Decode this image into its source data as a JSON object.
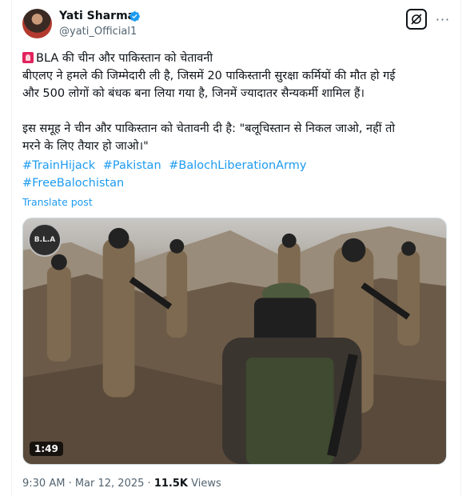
{
  "author": {
    "name": "Yati Sharma",
    "handle": "@yati_Official1",
    "verified": true,
    "verified_color": "#1d9bf0"
  },
  "header_actions": {
    "grok_icon": "grok-icon",
    "more_icon": "more-icon",
    "more_label": "···"
  },
  "tweet": {
    "line1": "BLA की चीन और पाकिस्तान को चेतावनी",
    "line2": "बीएलए ने हमले की जिम्मेदारी ली है, जिसमें 20 पाकिस्तानी सुरक्षा कर्मियों की मौत हो गई",
    "line3": "और 500 लोगों को बंधक बना लिया गया है, जिनमें ज्यादातर सैन्यकर्मी शामिल हैं।",
    "line4": "इस समूह ने चीन और पाकिस्तान को चेतावनी दी है: \"बलूचिस्तान से निकल जाओ, नहीं तो",
    "line5": "मरने के लिए तैयार हो जाओ।\"",
    "alert_icon": "alert-siren-icon"
  },
  "hashtags": [
    "#TrainHijack",
    "#Pakistan",
    "#BalochLiberationArmy",
    "#FreeBalochistan"
  ],
  "translate_label": "Translate post",
  "media": {
    "logo_text": "B.L.A",
    "duration": "1:49"
  },
  "meta": {
    "time": "9:30 AM",
    "separator": " · ",
    "date": "Mar 12, 2025",
    "views_count": "11.5K",
    "views_label": "Views"
  },
  "colors": {
    "link": "#1d9bf0",
    "secondary_text": "#536471",
    "primary_text": "#0f1419"
  }
}
